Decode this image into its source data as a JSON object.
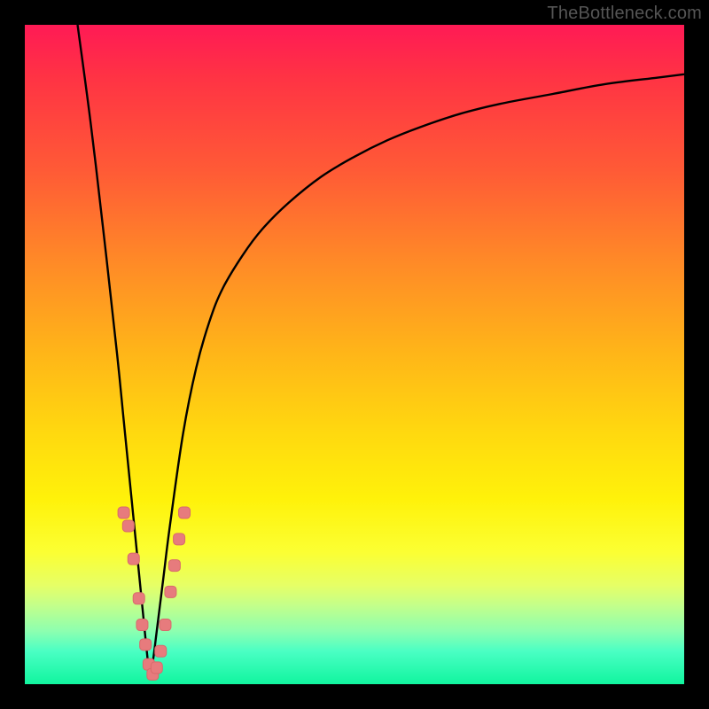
{
  "watermark": "TheBottleneck.com",
  "colors": {
    "frame": "#000000",
    "curve": "#000000",
    "marker_fill": "#e77b7d",
    "marker_stroke": "#d86a6c"
  },
  "chart_data": {
    "type": "line",
    "title": "",
    "xlabel": "",
    "ylabel": "",
    "xlim": [
      0,
      100
    ],
    "ylim": [
      0,
      100
    ],
    "grid": false,
    "note": "Axes are unlabeled in the source; x/y values are in percent of plot width/height with y=0 at bottom. Curve minimum near x≈19.",
    "series": [
      {
        "name": "bottleneck-curve",
        "x": [
          8,
          10,
          12,
          14,
          15,
          16,
          17,
          18,
          18.5,
          19,
          19.5,
          20,
          21,
          22,
          24,
          26,
          28,
          30,
          33,
          36,
          40,
          45,
          50,
          55,
          60,
          66,
          72,
          80,
          88,
          96,
          100
        ],
        "y": [
          100,
          85,
          68,
          50,
          40,
          30,
          20,
          10,
          5,
          1,
          4,
          8,
          16,
          24,
          38,
          48,
          55,
          60,
          65,
          69,
          73,
          77,
          80,
          82.5,
          84.5,
          86.5,
          88,
          89.5,
          91,
          92,
          92.5
        ]
      }
    ],
    "markers": {
      "name": "sample-points",
      "shape": "rounded-square",
      "x": [
        15.0,
        15.7,
        16.5,
        17.3,
        17.8,
        18.3,
        18.8,
        19.4,
        20.0,
        20.6,
        21.3,
        22.1,
        22.7,
        23.4,
        24.2
      ],
      "y": [
        26,
        24,
        19,
        13,
        9,
        6,
        3,
        1.5,
        2.5,
        5,
        9,
        14,
        18,
        22,
        26
      ]
    }
  }
}
